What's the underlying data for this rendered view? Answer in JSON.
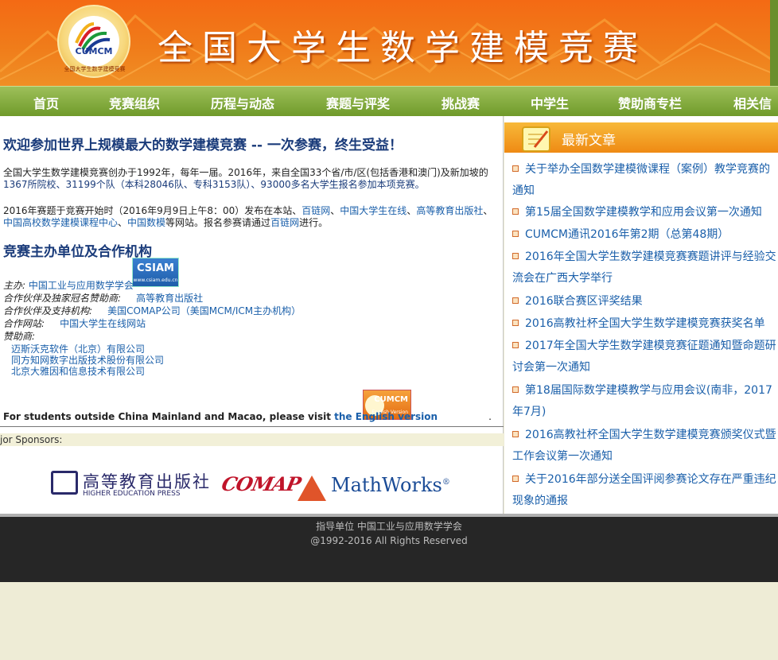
{
  "header": {
    "site_title": "全国大学生数学建模竞赛",
    "logo_text": "CUMCM",
    "logo_ring_text": "全国大学生数学建模竞赛"
  },
  "nav": {
    "items": [
      "首页",
      "竞赛组织",
      "历程与动态",
      "赛题与评奖",
      "挑战赛",
      "中学生",
      "赞助商专栏",
      "相关信"
    ]
  },
  "main": {
    "welcome_heading": "欢迎参加世界上规模最大的数学建模竞赛  -- 一次参赛，终生受益！",
    "intro_parts": {
      "p1a": "全国大学生数学建模竞赛创办于1992年，每年一届。2016年，来自全国33个省/市/区(包括香港和澳门)及新加坡的",
      "p1b": "1367所院校、31199个队（本科28046队、专科3153队）、93000多名大学生报名参加本项竞赛。",
      "p2a": "2016年赛题于竞赛开始时（2016年9月9日上午8：00）发布在本站、",
      "link1": "百链网",
      "sep1": "、",
      "link2": "中国大学生在线",
      "sep2": "、",
      "link3": "高等教育出版社",
      "sep3": "、",
      "link4": "中国高校数学建模课程中心",
      "sep4": "、",
      "link5": "中国数模",
      "p2b": "等网站。报名参赛请通过",
      "link6": "百链网",
      "p2c": "进行。"
    },
    "organizers_heading": "竞赛主办单位及合作机构",
    "organizers": {
      "host_label": "主办:",
      "host": "中国工业与应用数学学会",
      "partner_label": "合作伙伴及独家冠名赞助商:",
      "partner": "高等教育出版社",
      "support_label": "合作伙伴及支持机构:",
      "support": "美国COMAP公司（美国MCM/ICM主办机构）",
      "web_label": "合作网站:",
      "web": "中国大学生在线网站",
      "sponsor_label": "赞助商:",
      "sponsors": [
        "迈斯沃克软件（北京）有限公司",
        "同方知网数字出版技术股份有限公司",
        "北京大雅因和信息技术有限公司"
      ]
    },
    "csiam_badge": "CSIAM",
    "csiam_url": "www.csiam.edu.cn",
    "intl_text": "For students outside China Mainland and Macao, please visit",
    "intl_link": "the English version",
    "intl_period": ".",
    "english_badge": "CUMCM",
    "english_badge_sub": "English Version",
    "major_sponsors_label": "jor Sponsors:",
    "sponsor_logos": {
      "hep_cn": "高等教育出版社",
      "hep_en": "HIGHER EDUCATION PRESS",
      "comap": "COMAP",
      "mathworks": "MathWorks",
      "mathworks_reg": "®"
    }
  },
  "sidebar": {
    "title": "最新文章",
    "articles": [
      "关于举办全国数学建模微课程（案例）教学竞赛的通知",
      "第15届全国数学建模教学和应用会议第一次通知",
      "CUMCM通讯2016年第2期（总第48期）",
      "2016年全国大学生数学建模竞赛赛题讲评与经验交流会在广西大学举行",
      "2016联合赛区评奖结果",
      "2016高教社杯全国大学生数学建模竞赛获奖名单",
      "2017年全国大学生数学建模竞赛征题通知暨命题研讨会第一次通知",
      "第18届国际数学建模教学与应用会议(南非，2017年7月)",
      "2016高教社杯全国大学生数学建模竞赛颁奖仪式暨工作会议第一次通知",
      "关于2016年部分送全国评阅参赛论文存在严重违纪现象的通报"
    ]
  },
  "footer": {
    "line1": "指导单位  中国工业与应用数学学会",
    "line2": "@1992-2016 All Rights Reserved"
  },
  "colors": {
    "banner_orange": "#f07c1a",
    "nav_green": "#7ea83a",
    "link_blue": "#1a5faa",
    "heading_navy": "#1a3b7a",
    "footer_dark": "#262626"
  }
}
